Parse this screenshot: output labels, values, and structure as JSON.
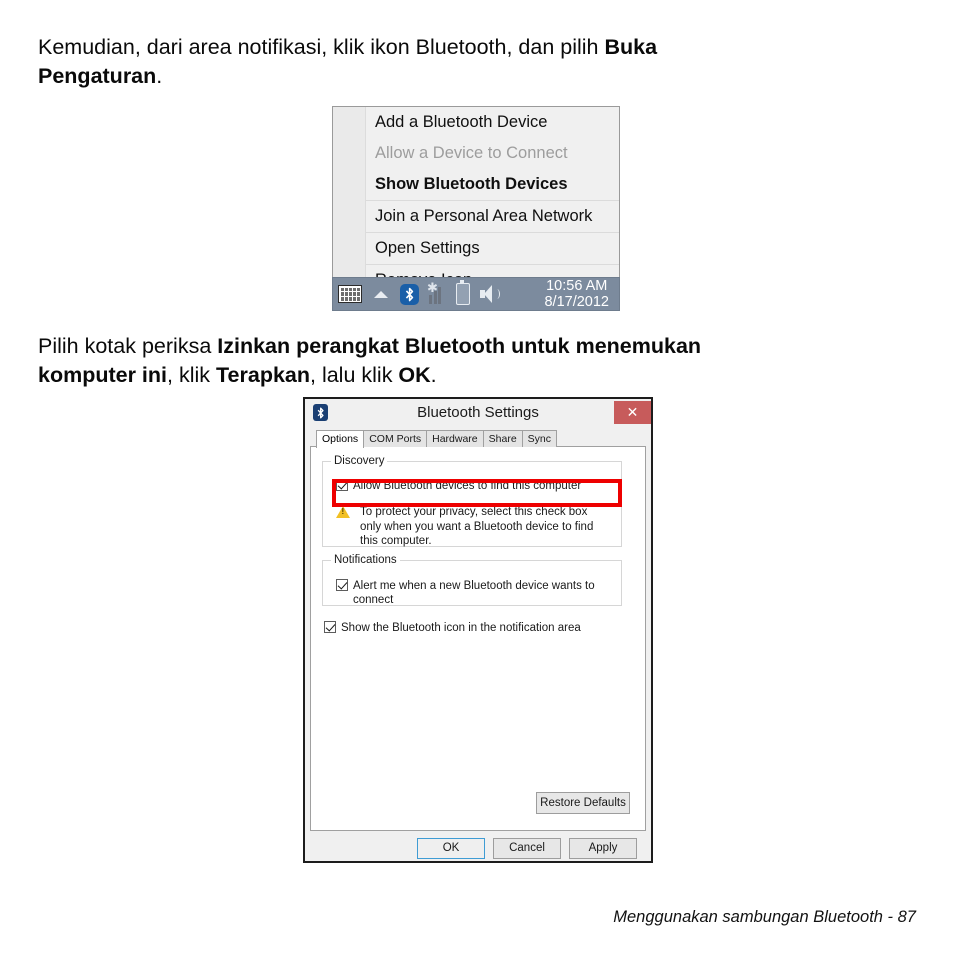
{
  "document": {
    "paragraph1": {
      "line1_prefix": "Kemudian, dari area notifikasi, klik ikon Bluetooth, dan pilih ",
      "line1_bold": "Buka",
      "line2_bold": "Pengaturan",
      "line2_suffix": "."
    },
    "paragraph2": {
      "seg1": "Pilih kotak periksa ",
      "bold1": "Izinkan perangkat Bluetooth untuk menemukan",
      "bold1_cont": "komputer ini",
      "seg2": ", klik ",
      "bold2": "Terapkan",
      "seg3": ", lalu klik ",
      "bold3": "OK",
      "seg4": "."
    },
    "footer": "Menggunakan sambungan Bluetooth -  87"
  },
  "tray_menu": {
    "items": [
      {
        "label": "Add a Bluetooth Device",
        "state": "normal"
      },
      {
        "label": "Allow a Device to Connect",
        "state": "disabled"
      },
      {
        "label": "Show Bluetooth Devices",
        "state": "bold"
      },
      {
        "label": "Join a Personal Area Network",
        "state": "normal"
      },
      {
        "label": "Open Settings",
        "state": "normal"
      },
      {
        "label": "Remove Icon",
        "state": "normal"
      }
    ]
  },
  "taskbar": {
    "icons": [
      "keyboard-icon",
      "chevron-up-icon",
      "bluetooth-icon",
      "wireless-signal-icon",
      "battery-icon",
      "speaker-icon"
    ],
    "clock_time": "10:56 AM",
    "clock_date": "8/17/2012",
    "background_color": "#7c8b9e"
  },
  "dialog": {
    "title": "Bluetooth Settings",
    "close_label": "✕",
    "close_color": "#c75b5b",
    "tabs": [
      {
        "label": "Options",
        "active": true
      },
      {
        "label": "COM Ports",
        "active": false
      },
      {
        "label": "Hardware",
        "active": false
      },
      {
        "label": "Share",
        "active": false
      },
      {
        "label": "Sync",
        "active": false
      }
    ],
    "discovery": {
      "group_label": "Discovery",
      "checkbox_label": "Allow Bluetooth devices to find this computer",
      "checkbox_checked": true,
      "warning_text": "To protect your privacy, select this check box only when you want a Bluetooth device to find this computer.",
      "highlight_color": "#ee0000"
    },
    "notifications": {
      "group_label": "Notifications",
      "checkbox_label": "Alert me when a new Bluetooth device wants to connect",
      "checkbox_checked": true
    },
    "tray_option": {
      "checkbox_label": "Show the Bluetooth icon in the notification area",
      "checkbox_checked": true
    },
    "restore_defaults_label": "Restore Defaults",
    "buttons": {
      "ok": "OK",
      "cancel": "Cancel",
      "apply": "Apply"
    }
  }
}
